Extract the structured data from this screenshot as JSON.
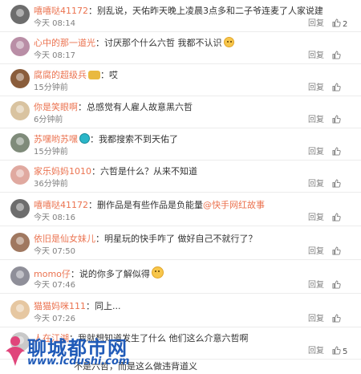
{
  "comments": [
    {
      "user": "嘻嘻哒41172",
      "text": "别乱说，天佑昨天晚上凌晨3点多和二子爷连麦了人家说建议不要带节奏",
      "time": "今天 08:14",
      "reply": "回复",
      "likes": "2",
      "avatar_color": "#6d6d6d"
    },
    {
      "user": "心中的那一道光",
      "text": "讨厌那个什么六哲 我都不认识",
      "time": "今天 08:17",
      "reply": "回复",
      "likes": "",
      "avatar_color": "#b98ea6",
      "emoji": "sad"
    },
    {
      "user": "腐腐的超级兵",
      "text": "哎",
      "time": "15分钟前",
      "reply": "回复",
      "likes": "",
      "avatar_color": "#8a5d3b",
      "emoji_before": "badge"
    },
    {
      "user": "你是笑眼啊",
      "text": "总感觉有人雇人故意黑六哲",
      "time": "6分钟前",
      "reply": "回复",
      "likes": "",
      "avatar_color": "#d9c3a0"
    },
    {
      "user": "苏嘿哟苏嘿",
      "text": "我都搜索不到天佑了",
      "time": "15分钟前",
      "reply": "回复",
      "likes": "",
      "avatar_color": "#7f8b7a",
      "emoji_before": "robot"
    },
    {
      "user": "家乐妈妈1010",
      "text": "六哲是什么？从来不知道",
      "time": "36分钟前",
      "reply": "回复",
      "likes": "",
      "avatar_color": "#e0a9a0"
    },
    {
      "user": "嘻嘻哒41172",
      "text": "删作品是有些作品是负能量",
      "tag": "@快手网红故事",
      "time": "今天 08:16",
      "reply": "回复",
      "likes": "",
      "avatar_color": "#6d6d6d"
    },
    {
      "user": "依旧是仙女妹儿",
      "text": "明星玩的快手咋了 做好自己不就行了？",
      "time": "今天 07:50",
      "reply": "回复",
      "likes": "",
      "avatar_color": "#a07860"
    },
    {
      "user": "momo仔",
      "text": "说的你多了解似得",
      "time": "今天 07:46",
      "reply": "回复",
      "likes": "",
      "avatar_color": "#8f8f99",
      "emoji": "grin"
    },
    {
      "user": "猫猫妈咪111",
      "text": "同上...",
      "time": "今天 07:26",
      "reply": "回复",
      "likes": "",
      "avatar_color": "#e6c7a1"
    },
    {
      "user": "人在江湖",
      "text": "我就想知道发生了什么 他们这么介意六哲啊",
      "time": "",
      "reply": "回复",
      "likes": "5",
      "avatar_color": "#c9c9c9"
    },
    {
      "user": "",
      "text": "不是六哲，而是这么做违背道义",
      "time": "",
      "reply": "",
      "likes": "",
      "avatar_color": "#c9c9c9"
    }
  ],
  "ui": {
    "colon": "："
  },
  "watermark": {
    "brand": "聊城都市网",
    "url": "www.lcdushi.com"
  },
  "colors": {
    "username": "#eb7350",
    "text": "#333333",
    "meta": "#808080",
    "watermark": "#1f5ab8"
  }
}
